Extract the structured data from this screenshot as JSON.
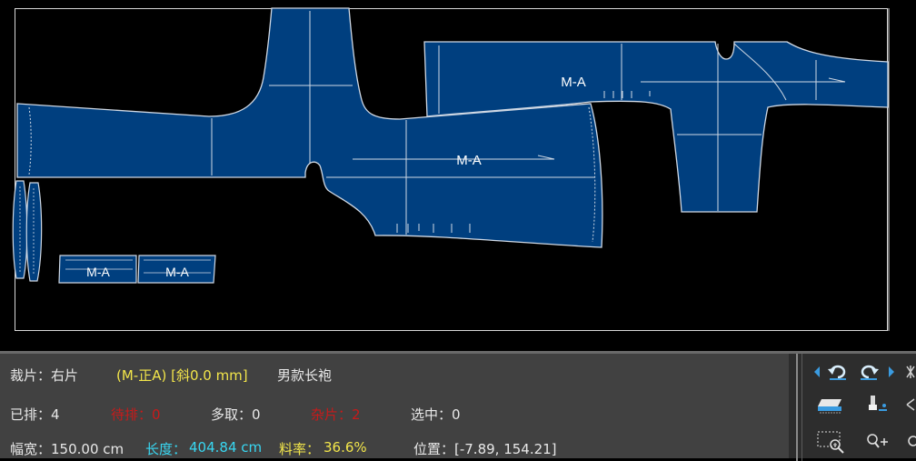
{
  "pieces": {
    "sleeve_label": "M-A",
    "body_label": "M-A",
    "small1_label": "M-A",
    "small2_label": "M-A"
  },
  "status": {
    "piece_name": "裁片：右片",
    "piece_info": "(M-正A) [斜0.0 mm]",
    "style_name": "男款长袍",
    "arranged": "已排：4",
    "pending": "待排：0",
    "extra": "多取：0",
    "misc": "杂片：2",
    "selected": "选中：0",
    "width_label": "幅宽：150.00 cm",
    "length_label": "长度：",
    "length_value": "404.84 cm",
    "rate_label": "料率：",
    "rate_value": "36.6%",
    "position": "位置：[-7.89, 154.21]"
  },
  "colors": {
    "piece_fill": "#003f7f",
    "background": "#000000",
    "status_bar": "#414141",
    "accent_yellow": "#f2e54a",
    "accent_red": "#c81a1a",
    "accent_cyan": "#38d7f2"
  },
  "toolbar": {
    "icons": [
      "arrow-left-icon",
      "undo-icon",
      "redo-icon",
      "arrow-right-icon",
      "fabric-spread-icon",
      "marker-pen-icon",
      "zoom-area-icon",
      "zoom-in-icon"
    ]
  }
}
